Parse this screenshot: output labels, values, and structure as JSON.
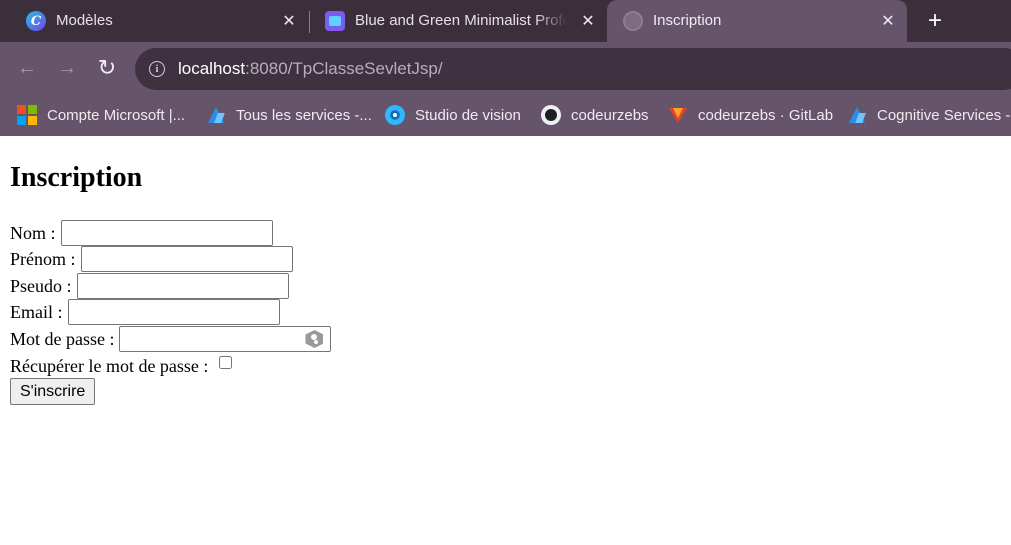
{
  "browser": {
    "tabs": [
      {
        "title": "Modèles",
        "icon": "canva-icon",
        "active": false
      },
      {
        "title": "Blue and Green Minimalist Profe",
        "icon": "canva-design-icon",
        "active": false
      },
      {
        "title": "Inscription",
        "icon": "globe-icon",
        "active": true
      }
    ],
    "new_tab": "+",
    "close_glyph": "✕",
    "address": {
      "host": "localhost",
      "path": ":8080/TpClasseSevletJsp/"
    },
    "bookmarks": [
      {
        "label": "Compte Microsoft |...",
        "icon": "microsoft-icon"
      },
      {
        "label": "Tous les services -...",
        "icon": "azure-icon"
      },
      {
        "label": "Studio de vision",
        "icon": "vision-studio-icon"
      },
      {
        "label": "codeurzebs",
        "icon": "github-icon"
      },
      {
        "label": "codeurzebs · GitLab",
        "icon": "gitlab-icon"
      },
      {
        "label": "Cognitive Services -...",
        "icon": "azure-icon"
      }
    ],
    "colors": {
      "tab_strip": "#3c2f3c",
      "toolbar": "#66546a",
      "omnibox": "#3f3240"
    }
  },
  "page": {
    "heading": "Inscription",
    "fields": {
      "nom": {
        "label": "Nom :",
        "value": ""
      },
      "prenom": {
        "label": "Prénom :",
        "value": ""
      },
      "pseudo": {
        "label": "Pseudo :",
        "value": ""
      },
      "email": {
        "label": "Email :",
        "value": ""
      },
      "password": {
        "label": "Mot de passe :",
        "value": ""
      },
      "recover": {
        "label": "Récupérer le mot de passe :",
        "checked": false
      }
    },
    "submit_label": "S'inscrire"
  }
}
